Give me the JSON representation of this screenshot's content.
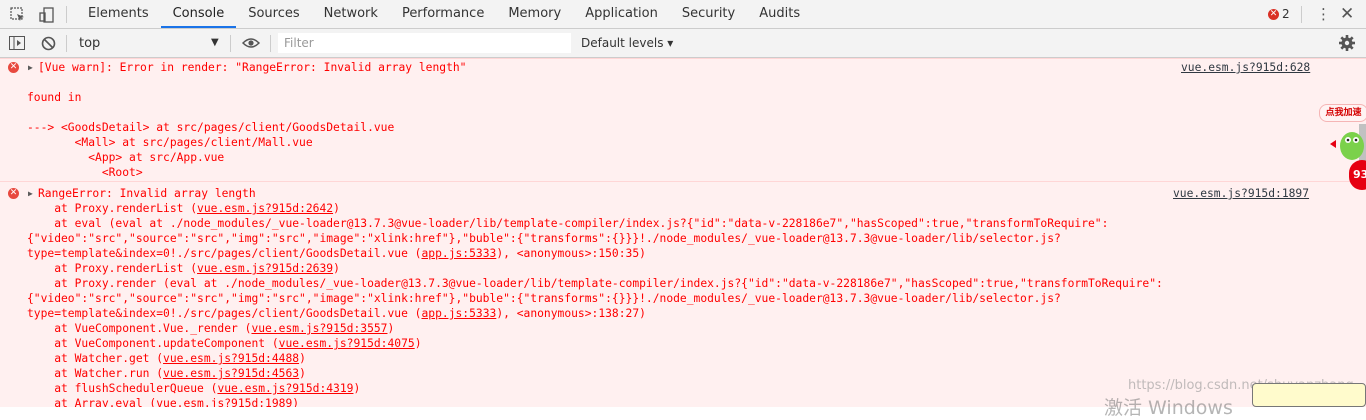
{
  "tabs": [
    {
      "label": "Elements"
    },
    {
      "label": "Console"
    },
    {
      "label": "Sources"
    },
    {
      "label": "Network"
    },
    {
      "label": "Performance"
    },
    {
      "label": "Memory"
    },
    {
      "label": "Application"
    },
    {
      "label": "Security"
    },
    {
      "label": "Audits"
    }
  ],
  "active_tab": "Console",
  "error_count": "2",
  "toolbar": {
    "context": "top",
    "filter_placeholder": "Filter",
    "levels_label": "Default levels ▾"
  },
  "messages": [
    {
      "source": "vue.esm.js?915d:628",
      "lines": [
        "[Vue warn]: Error in render: \"RangeError: Invalid array length\"",
        "",
        "found in",
        "",
        "---> <GoodsDetail> at src/pages/client/GoodsDetail.vue",
        "       <Mall> at src/pages/client/Mall.vue",
        "         <App> at src/App.vue",
        "           <Root>"
      ]
    },
    {
      "source": "vue.esm.js?915d:1897",
      "lines": [
        [
          "RangeError: Invalid array length"
        ],
        [
          "    at Proxy.renderList (",
          {
            "link": "vue.esm.js?915d:2642"
          },
          ")"
        ],
        [
          "    at eval (eval at ./node_modules/_vue-loader@13.7.3@vue-loader/lib/template-compiler/index.js?{\"id\":\"data-v-228186e7\",\"hasScoped\":true,\"transformToRequire\":"
        ],
        [
          "{\"video\":\"src\",\"source\":\"src\",\"img\":\"src\",\"image\":\"xlink:href\"},\"buble\":{\"transforms\":{}}}!./node_modules/_vue-loader@13.7.3@vue-loader/lib/selector.js?"
        ],
        [
          "type=template&index=0!./src/pages/client/GoodsDetail.vue (",
          {
            "link": "app.js:5333"
          },
          "), <anonymous>:150:35)"
        ],
        [
          "    at Proxy.renderList (",
          {
            "link": "vue.esm.js?915d:2639"
          },
          ")"
        ],
        [
          "    at Proxy.render (eval at ./node_modules/_vue-loader@13.7.3@vue-loader/lib/template-compiler/index.js?{\"id\":\"data-v-228186e7\",\"hasScoped\":true,\"transformToRequire\":"
        ],
        [
          "{\"video\":\"src\",\"source\":\"src\",\"img\":\"src\",\"image\":\"xlink:href\"},\"buble\":{\"transforms\":{}}}!./node_modules/_vue-loader@13.7.3@vue-loader/lib/selector.js?"
        ],
        [
          "type=template&index=0!./src/pages/client/GoodsDetail.vue (",
          {
            "link": "app.js:5333"
          },
          "), <anonymous>:138:27)"
        ],
        [
          "    at VueComponent.Vue._render (",
          {
            "link": "vue.esm.js?915d:3557"
          },
          ")"
        ],
        [
          "    at VueComponent.updateComponent (",
          {
            "link": "vue.esm.js?915d:4075"
          },
          ")"
        ],
        [
          "    at Watcher.get (",
          {
            "link": "vue.esm.js?915d:4488"
          },
          ")"
        ],
        [
          "    at Watcher.run (",
          {
            "link": "vue.esm.js?915d:4563"
          },
          ")"
        ],
        [
          "    at flushSchedulerQueue (",
          {
            "link": "vue.esm.js?915d:4319"
          },
          ")"
        ],
        [
          "    at Array.eval (",
          {
            "link": "vue.esm.js?915d:1989"
          },
          ")"
        ]
      ]
    }
  ],
  "overlay": {
    "badge_text": "点我加速",
    "badge_number": "93",
    "watermark": "https://blog.csdn.net/shuyanzhang",
    "activate_windows": "激活 Windows"
  },
  "colors": {
    "error_text": "#ff0000",
    "error_bg": "#fff0f0",
    "accent": "#1a73e8"
  },
  "icons": [
    "inspect-icon",
    "device-icon",
    "error-icon",
    "kebab-icon",
    "close-icon",
    "sidebar-toggle-icon",
    "clear-console-icon",
    "eye-icon",
    "settings-gear-icon",
    "expand-triangle-icon"
  ]
}
